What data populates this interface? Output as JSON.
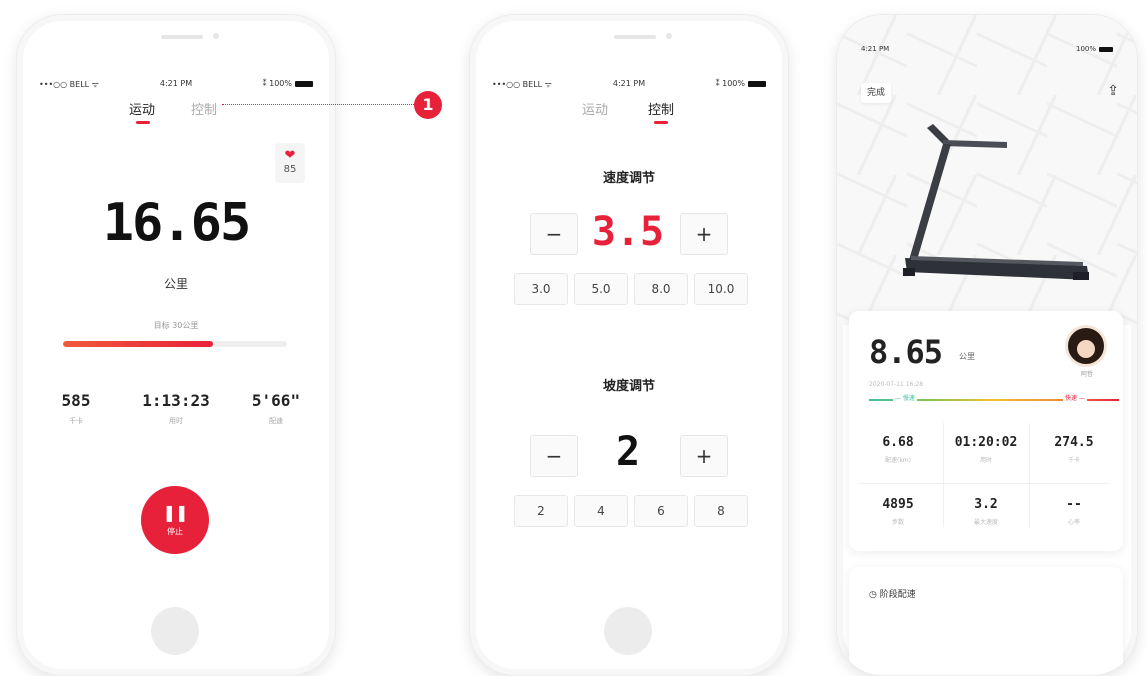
{
  "phone1": {
    "status": {
      "carrier": "•••○○ BELL ᯤ",
      "time": "4:21 PM",
      "battery": "⁑ 100%"
    },
    "tabs": [
      {
        "label": "运动"
      },
      {
        "label": "控制"
      }
    ],
    "heart_rate": "85",
    "distance": "16.65",
    "distance_unit": "公里",
    "goal_label": "目标 30公里",
    "goal_progress_fraction": 0.67,
    "stats": [
      {
        "value": "585",
        "label": "千卡"
      },
      {
        "value": "1:13:23",
        "label": "用时"
      },
      {
        "value": "5'66\"",
        "label": "配速"
      }
    ],
    "pause_button": {
      "icon": "❚❚",
      "label": "停止"
    }
  },
  "callout": {
    "number": "1"
  },
  "phone2": {
    "status": {
      "carrier": "•••○○ BELL ᯤ",
      "time": "4:21 PM",
      "battery": "⁑ 100%"
    },
    "tabs": [
      {
        "label": "运动"
      },
      {
        "label": "控制"
      }
    ],
    "speed": {
      "title": "速度调节",
      "minus": "−",
      "value": "3.5",
      "plus": "+",
      "presets": [
        "3.0",
        "5.0",
        "8.0",
        "10.0"
      ]
    },
    "incline": {
      "title": "坡度调节",
      "minus": "−",
      "value": "2",
      "plus": "+",
      "presets": [
        "2",
        "4",
        "6",
        "8"
      ]
    }
  },
  "phone3": {
    "status": {
      "time": "4:21 PM",
      "battery": "100%"
    },
    "done_button": "完成",
    "share_icon": "⇪",
    "summary": {
      "distance": "8.65",
      "distance_unit": "公里",
      "date": "2020-07-11 16:28",
      "avatar_name": "阿哲",
      "pace_low": "— 慢速",
      "pace_high": "快速 —",
      "metrics": [
        {
          "value": "6.68",
          "label": "配速(km)"
        },
        {
          "value": "01:20:02",
          "label": "用时"
        },
        {
          "value": "274.5",
          "label": "千卡"
        },
        {
          "value": "4895",
          "label": "步数"
        },
        {
          "value": "3.2",
          "label": "最大速度"
        },
        {
          "value": "--",
          "label": "心率"
        }
      ]
    },
    "pace_section_title": "◷ 阶段配速"
  },
  "colors": {
    "accent": "#e8213a",
    "background": "#ffffff"
  }
}
